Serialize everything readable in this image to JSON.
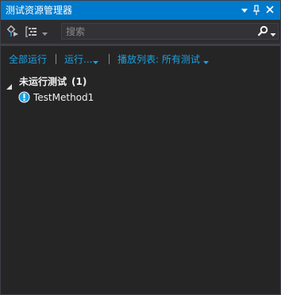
{
  "window": {
    "title": "测试资源管理器",
    "buttons": [
      "dropdown-icon",
      "pin-icon",
      "close-icon"
    ]
  },
  "toolbar": {
    "search_placeholder": "搜索",
    "icons": [
      "run-tests-icon",
      "group-by-icon",
      "chevron-down-icon",
      "search-icon"
    ]
  },
  "commands": {
    "run_all": "全部运行",
    "run": "运行...",
    "playlist": "播放列表: 所有测试"
  },
  "tree": {
    "group_label": "未运行测试",
    "group_count": "(1)",
    "items": [
      {
        "label": "TestMethod1",
        "icon": "not-run-test-icon"
      }
    ]
  },
  "colors": {
    "title_bar": "#007acc",
    "background": "#252526",
    "link": "#1ba1e2",
    "text": "#f1f1f1"
  }
}
